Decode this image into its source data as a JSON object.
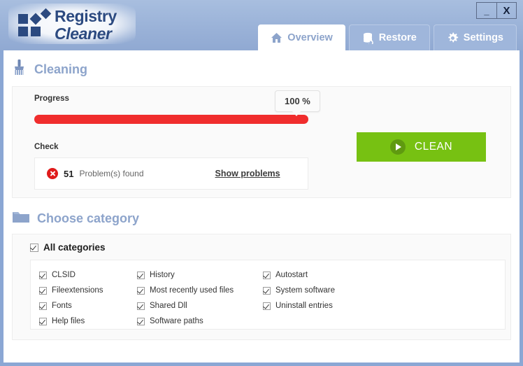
{
  "app": {
    "logo_line1": "Registry",
    "logo_line2": "Cleaner"
  },
  "window_controls": {
    "minimize": "_",
    "close": "X"
  },
  "tabs": [
    {
      "label": "Overview",
      "icon": "home-icon",
      "active": true
    },
    {
      "label": "Restore",
      "icon": "database-restore-icon",
      "active": false
    },
    {
      "label": "Settings",
      "icon": "gear-icon",
      "active": false
    }
  ],
  "cleaning": {
    "title": "Cleaning",
    "icon": "brush-icon",
    "progress_label": "Progress",
    "progress_percent_text": "100 %",
    "progress_value": 100,
    "check_label": "Check",
    "problem_count": "51",
    "problem_text": "Problem(s) found",
    "problem_icon": "error-circle-icon",
    "show_problems_link": "Show problems",
    "clean_button_label": "CLEAN",
    "clean_button_icon": "play-icon"
  },
  "category": {
    "title": "Choose category",
    "icon": "folder-icon",
    "all_label": "All categories",
    "all_checked": true,
    "columns": [
      [
        {
          "label": "CLSID",
          "checked": true
        },
        {
          "label": "Fileextensions",
          "checked": true
        },
        {
          "label": "Fonts",
          "checked": true
        },
        {
          "label": "Help files",
          "checked": true
        }
      ],
      [
        {
          "label": "History",
          "checked": true
        },
        {
          "label": "Most recently used files",
          "checked": true
        },
        {
          "label": "Shared Dll",
          "checked": true
        },
        {
          "label": "Software paths",
          "checked": true
        }
      ],
      [
        {
          "label": "Autostart",
          "checked": true
        },
        {
          "label": "System software",
          "checked": true
        },
        {
          "label": "Uninstall entries",
          "checked": true
        }
      ]
    ]
  },
  "colors": {
    "header_blue": "#9ab2d8",
    "accent_blue": "#8da4cb",
    "logo_navy": "#2c4a80",
    "progress_red": "#f02d2d",
    "clean_green": "#77c112",
    "error_red": "#e01b1b"
  }
}
